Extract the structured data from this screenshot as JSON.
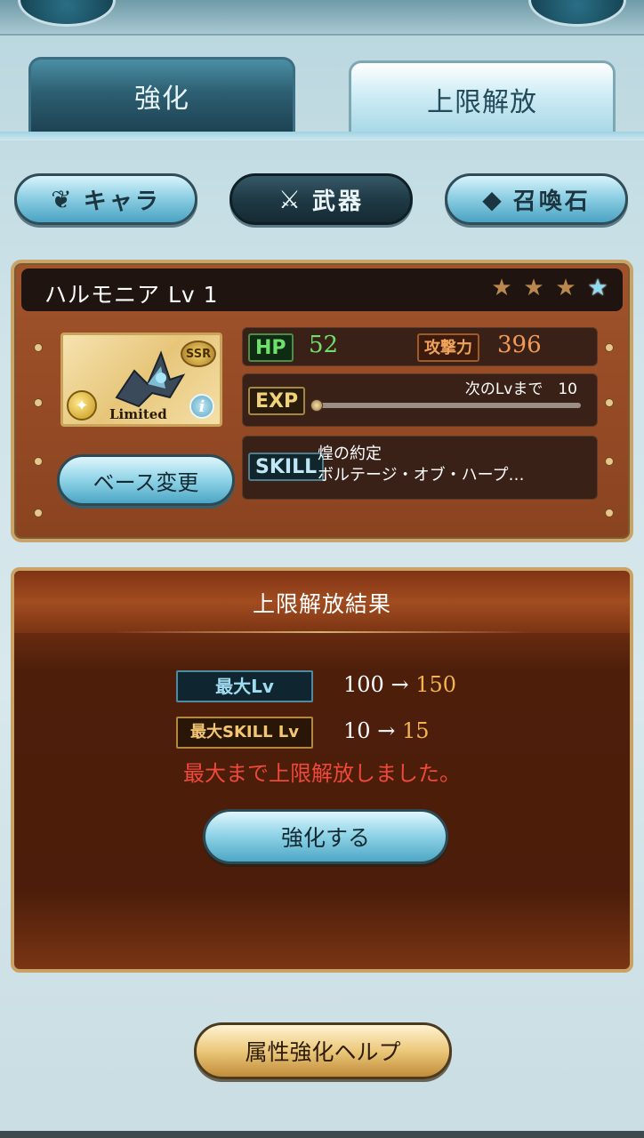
{
  "tabs": [
    {
      "label": "強化",
      "active": false
    },
    {
      "label": "上限解放",
      "active": true
    }
  ],
  "categories": [
    {
      "label": "キャラ",
      "icon": "ornament-icon",
      "selected": false
    },
    {
      "label": "武器",
      "icon": "crossed-swords-icon",
      "selected": true
    },
    {
      "label": "召喚石",
      "icon": "crystal-icon",
      "selected": false
    }
  ],
  "character": {
    "name": "ハルモニア Lv 1",
    "stars": [
      "bronze-star",
      "bronze-star",
      "bronze-star",
      "blue-star"
    ],
    "rarity": "SSR",
    "badge": "Limited",
    "base_change_label": "ベース変更",
    "hp_label": "HP",
    "hp_value": "52",
    "atk_label": "攻撃力",
    "atk_value": "396",
    "exp_label": "EXP",
    "next_lv_text": "次のLvまで　10",
    "exp_progress": 0,
    "skill_label": "SKILL",
    "skill_1": "煌の約定",
    "skill_2": "ボルテージ・オブ・ハープ…"
  },
  "result": {
    "title": "上限解放結果",
    "max_lv_label": "最大Lv",
    "max_lv_from": "100",
    "arrow": "→",
    "max_lv_to": "150",
    "max_skill_label": "最大SKILL Lv",
    "max_skill_from": "10",
    "max_skill_to": "15",
    "message": "最大まで上限解放しました。",
    "enhance_label": "強化する"
  },
  "help_label": "属性強化ヘルプ",
  "colors": {
    "accent_blue": "#8fd0e4",
    "panel_brown": "#8a4320",
    "alert_red": "#f0483a",
    "hp_green": "#6fe06a",
    "atk_orange": "#f39a56"
  }
}
